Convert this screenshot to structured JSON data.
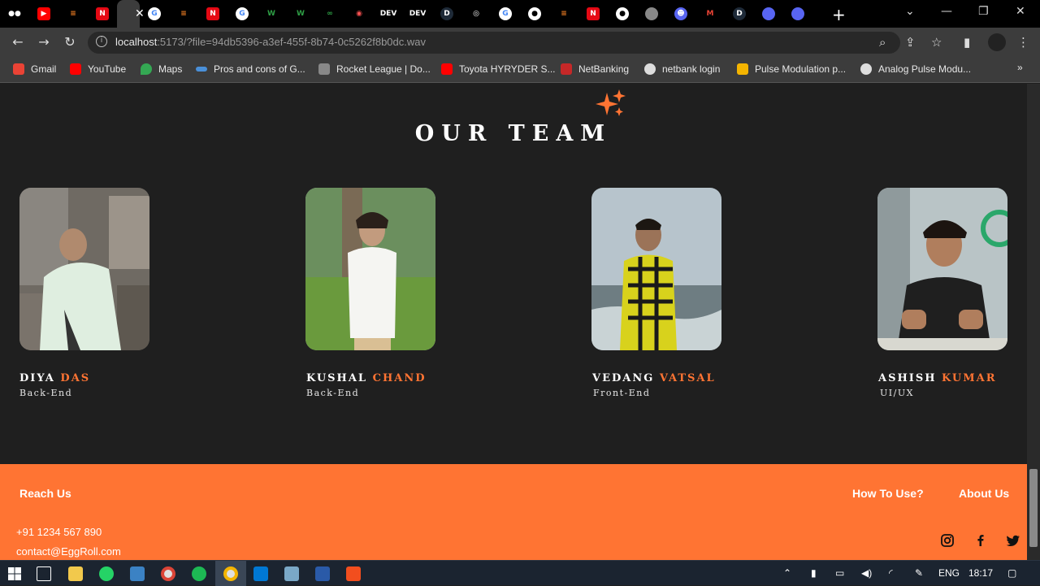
{
  "browser": {
    "url_host": "localhost",
    "url_rest": ":5173/?file=94db5396-a3ef-455f-8b74-0c5262f8b0dc.wav",
    "tabs": [
      "medium-icon",
      "youtube-icon",
      "stack-icon",
      "netflix-icon",
      "active",
      "google-icon",
      "stack-icon",
      "netflix-icon",
      "google-icon",
      "w-icon",
      "w-icon",
      "infinity-icon",
      "record-icon",
      "dev-icon",
      "dev-icon",
      "d-icon",
      "chrome-icon",
      "google-icon",
      "github-icon",
      "stack-icon",
      "netflix-icon",
      "github-icon",
      "globe-icon",
      "discord-icon",
      "gmail-icon",
      "d-icon",
      "app-icon",
      "app-icon"
    ],
    "dev_label": "DEV",
    "d_label": "D"
  },
  "bookmarks": [
    {
      "label": "Gmail",
      "color": "#ea4335"
    },
    {
      "label": "YouTube",
      "color": "#ff0000"
    },
    {
      "label": "Maps",
      "color": "#34a853"
    },
    {
      "label": "Pros and cons of G...",
      "color": "#4a90d9"
    },
    {
      "label": "Rocket League | Do...",
      "color": "#888888"
    },
    {
      "label": "Toyota HYRYDER S...",
      "color": "#ff0000"
    },
    {
      "label": "NetBanking",
      "color": "#c62828"
    },
    {
      "label": "netbank login",
      "color": "#dddddd"
    },
    {
      "label": "Pulse Modulation p...",
      "color": "#f4b400"
    },
    {
      "label": "Analog Pulse Modu...",
      "color": "#dddddd"
    }
  ],
  "page": {
    "section_title": "OUR TEAM",
    "members": [
      {
        "first": "DIYA",
        "last": "DAS",
        "role": "Back-End"
      },
      {
        "first": "KUSHAL",
        "last": "CHAND",
        "role": "Back-End"
      },
      {
        "first": "VEDANG",
        "last": "VATSAL",
        "role": "Front-End"
      },
      {
        "first": "ASHISH",
        "last": "KUMAR",
        "role": "UI/UX"
      }
    ],
    "accent": "#ff7433"
  },
  "footer": {
    "reach": "Reach Us",
    "how_to": "How To Use?",
    "about": "About Us",
    "phone": "+91 1234 567 890",
    "email": "contact@EggRoll.com"
  },
  "taskbar": {
    "lang": "ENG",
    "time": "18:17"
  }
}
